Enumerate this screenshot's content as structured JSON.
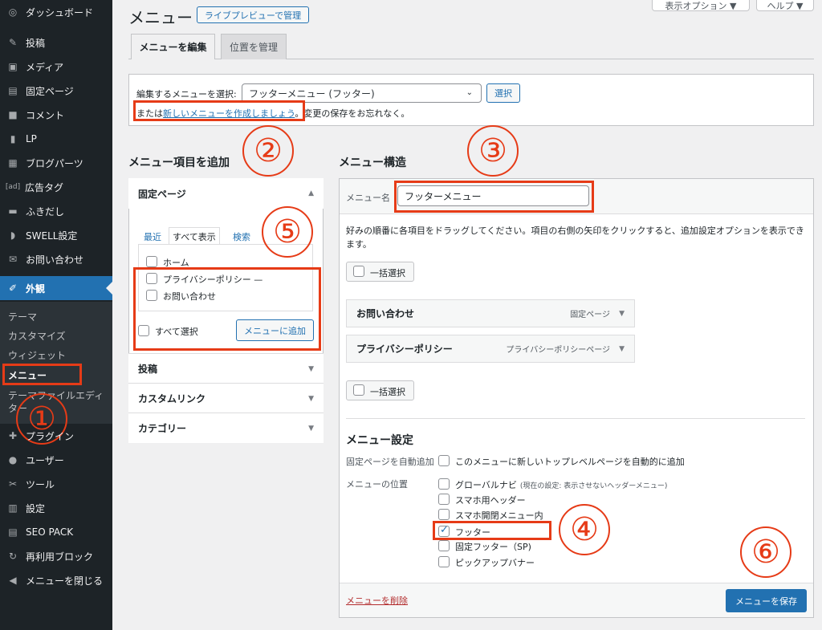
{
  "sidebar": {
    "items": [
      {
        "icon": "dashboard-icon",
        "glyph": "◎",
        "label": "ダッシュボード"
      },
      {
        "icon": "pin-icon",
        "glyph": "✎",
        "label": "投稿"
      },
      {
        "icon": "media-icon",
        "glyph": "▣",
        "label": "メディア"
      },
      {
        "icon": "page-icon",
        "glyph": "▤",
        "label": "固定ページ"
      },
      {
        "icon": "comment-icon",
        "glyph": "■",
        "label": "コメント"
      },
      {
        "icon": "document-icon",
        "glyph": "▮",
        "label": "LP"
      },
      {
        "icon": "blocks-icon",
        "glyph": "▦",
        "label": "ブログパーツ"
      },
      {
        "icon": "ad-icon",
        "glyph": "[ad]",
        "label": "広告タグ"
      },
      {
        "icon": "balloon-icon",
        "glyph": "▬",
        "label": "ふきだし"
      },
      {
        "icon": "swell-icon",
        "glyph": "◗",
        "label": "SWELL設定"
      },
      {
        "icon": "mail-icon",
        "glyph": "✉",
        "label": "お問い合わせ"
      },
      {
        "icon": "brush-icon",
        "glyph": "✐",
        "label": "外観"
      },
      {
        "icon": "plugin-icon",
        "glyph": "✚",
        "label": "プラグイン"
      },
      {
        "icon": "user-icon",
        "glyph": "●",
        "label": "ユーザー"
      },
      {
        "icon": "wrench-icon",
        "glyph": "✂",
        "label": "ツール"
      },
      {
        "icon": "settings-icon",
        "glyph": "▥",
        "label": "設定"
      },
      {
        "icon": "seo-icon",
        "glyph": "▤",
        "label": "SEO PACK"
      },
      {
        "icon": "reuse-icon",
        "glyph": "↻",
        "label": "再利用ブロック"
      },
      {
        "icon": "collapse-icon",
        "glyph": "◀",
        "label": "メニューを閉じる"
      }
    ],
    "submenu": [
      "テーマ",
      "カスタマイズ",
      "ウィジェット",
      "メニュー",
      "テーマファイルエディター"
    ]
  },
  "header": {
    "title": "メニュー",
    "live_preview": "ライブプレビューで管理",
    "screen_options": "表示オプション ▼",
    "help": "ヘルプ ▼"
  },
  "tabs": [
    "メニューを編集",
    "位置を管理"
  ],
  "select_menu": {
    "label": "編集するメニューを選択:",
    "value": "フッターメニュー (フッター)",
    "select_button": "選択",
    "hint_prefix": "または",
    "hint_link": "新しいメニューを作成しましょう",
    "hint_suffix": "。変更の保存をお忘れなく。"
  },
  "add_items": {
    "heading": "メニュー項目を追加",
    "section_title": "固定ページ",
    "subtabs": [
      "最近",
      "すべて表示",
      "検索"
    ],
    "pages": [
      "ホーム",
      "プライバシーポリシー —",
      "お問い合わせ"
    ],
    "select_all": "すべて選択",
    "add_button": "メニューに追加",
    "other_sections": [
      "投稿",
      "カスタムリンク",
      "カテゴリー"
    ]
  },
  "structure": {
    "heading": "メニュー構造",
    "name_label": "メニュー名",
    "name_value": "フッターメニュー",
    "instructions": "好みの順番に各項目をドラッグしてください。項目の右側の矢印をクリックすると、追加設定オプションを表示できます。",
    "bulk_select": "一括選択",
    "items": [
      {
        "title": "お問い合わせ",
        "type": "固定ページ"
      },
      {
        "title": "プライバシーポリシー",
        "type": "プライバシーポリシーページ"
      }
    ],
    "settings_heading": "メニュー設定",
    "auto_add_label": "固定ページを自動追加",
    "auto_add_option": "このメニューに新しいトップレベルページを自動的に追加",
    "location_label": "メニューの位置",
    "locations": [
      {
        "name": "グローバルナビ",
        "note": "(現在の設定: 表示させないヘッダーメニュー)",
        "checked": false
      },
      {
        "name": "スマホ用ヘッダー",
        "note": "",
        "checked": false
      },
      {
        "name": "スマホ開閉メニュー内",
        "note": "",
        "checked": false
      },
      {
        "name": "フッター",
        "note": "",
        "checked": true
      },
      {
        "name": "固定フッター（SP)",
        "note": "",
        "checked": false
      },
      {
        "name": "ピックアップバナー",
        "note": "",
        "checked": false
      }
    ],
    "delete_link": "メニューを削除",
    "save_button": "メニューを保存"
  },
  "annotations": {
    "numbers": [
      "①",
      "②",
      "③",
      "④",
      "⑤",
      "⑥"
    ],
    "color": "#e63b17"
  }
}
